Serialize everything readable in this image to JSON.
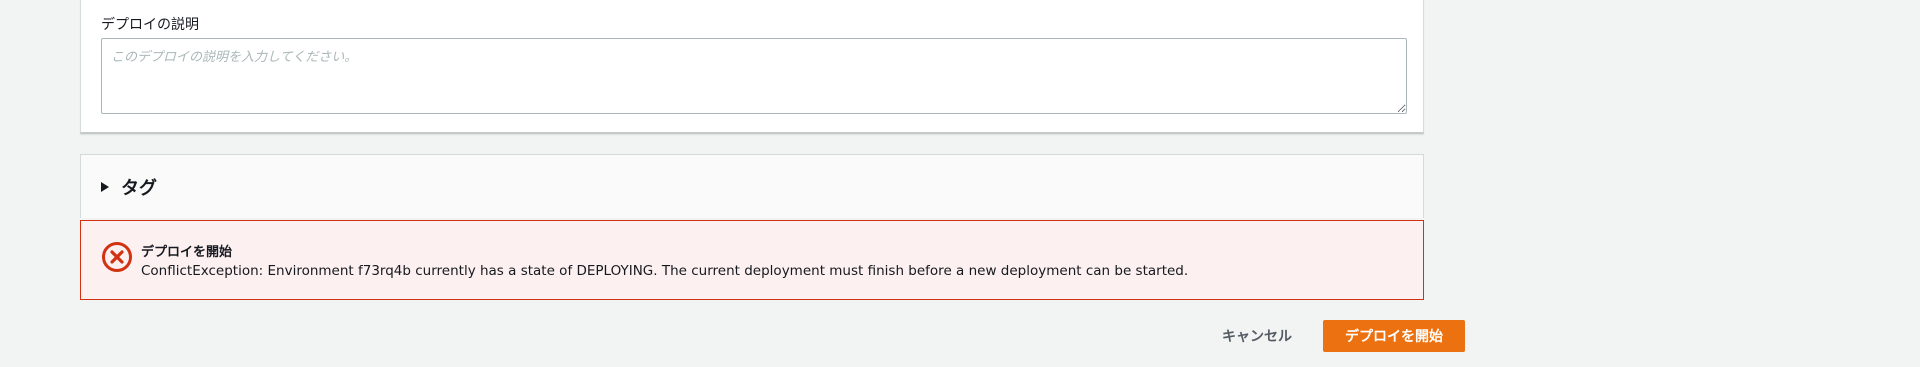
{
  "description_section": {
    "label": "デプロイの説明",
    "placeholder": "このデプロイの説明を入力してください。",
    "value": ""
  },
  "tags_section": {
    "title": "タグ",
    "expanded": false,
    "icon": "caret-right-icon"
  },
  "alert": {
    "type": "error",
    "icon": "error-circle-x-icon",
    "title": "デプロイを開始",
    "message": "ConflictException: Environment f73rq4b currently has a state of DEPLOYING. The current deployment must finish before a new deployment can be started.",
    "border_color": "#d13212",
    "background_color": "#fcf0f0"
  },
  "actions": {
    "cancel_label": "キャンセル",
    "submit_label": "デプロイを開始",
    "accent_color": "#ec7211"
  }
}
